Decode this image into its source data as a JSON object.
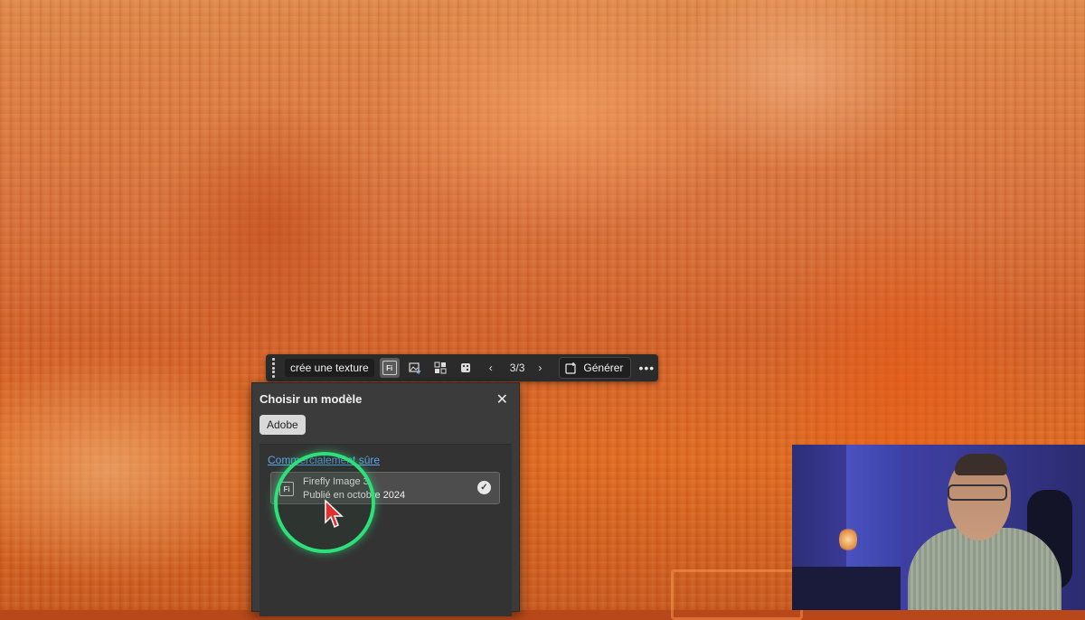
{
  "taskbar": {
    "prompt_text": "crée une texture",
    "model_badge": "Fi",
    "counter": "3/3",
    "generate_label": "Générer",
    "more_label": "•••"
  },
  "model_panel": {
    "title": "Choisir un modèle",
    "close_label": "✕",
    "provider_pill": "Adobe",
    "section_label": "Commercialement sûre",
    "selected_model": {
      "badge": "Fi",
      "name": "Firefly Image 3",
      "published": "Publié en octobre 2024",
      "check": "✓"
    }
  },
  "colors": {
    "highlight_ring": "#2ee07a",
    "link": "#58a7ea",
    "panel_bg": "#3b3b3b",
    "toolbar_bg": "#2b2b2b"
  }
}
